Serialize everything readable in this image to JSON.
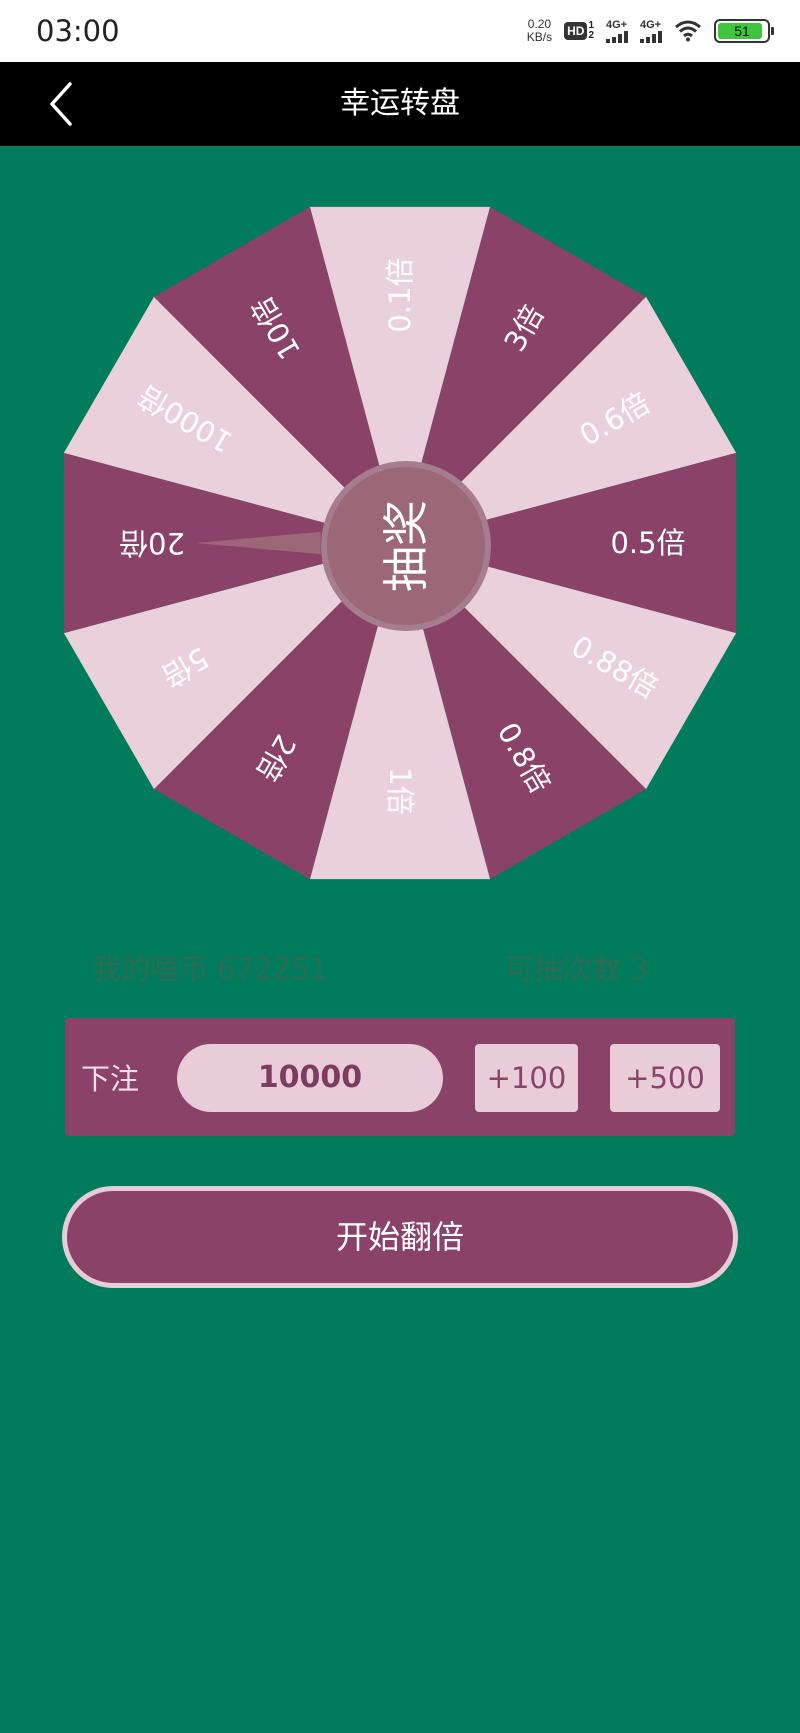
{
  "status_bar": {
    "time": "03:00",
    "net_speed_value": "0.20",
    "net_speed_unit": "KB/s",
    "hd_badge": "HD",
    "hd_sim1": "1",
    "hd_sim2": "2",
    "signal1_label": "4G+",
    "signal2_label": "4G+",
    "battery_level": "51",
    "icons": [
      "hd-icon",
      "signal-icon",
      "signal-icon",
      "wifi-icon",
      "battery-icon"
    ]
  },
  "header": {
    "title": "幸运转盘",
    "back_icon": "chevron-left-icon"
  },
  "wheel": {
    "center_label": "抽奖",
    "segments": [
      {
        "label": "0.1倍",
        "color": "#e9d0da"
      },
      {
        "label": "3倍",
        "color": "#8b4268"
      },
      {
        "label": "0.6倍",
        "color": "#e9d0da"
      },
      {
        "label": "0.5倍",
        "color": "#8b4268"
      },
      {
        "label": "0.88倍",
        "color": "#e9d0da"
      },
      {
        "label": "0.8倍",
        "color": "#8b4268"
      },
      {
        "label": "1倍",
        "color": "#e9d0da"
      },
      {
        "label": "2倍",
        "color": "#8b4268"
      },
      {
        "label": "5倍",
        "color": "#e9d0da"
      },
      {
        "label": "20倍",
        "color": "#8b4268"
      },
      {
        "label": "1000倍",
        "color": "#e9d0da"
      },
      {
        "label": "10倍",
        "color": "#8b4268"
      }
    ],
    "pointer_segment": "20倍"
  },
  "info": {
    "coins_text": "我的嗑币  672251",
    "draws_text": "可抽次数  3"
  },
  "bet": {
    "label": "下注",
    "amount": "10000",
    "plus100": "+100",
    "plus500": "+500"
  },
  "start_button": "开始翻倍",
  "colors": {
    "background": "#007c5c",
    "accent": "#8b4268",
    "light": "#e9d0da",
    "header": "#000000"
  }
}
